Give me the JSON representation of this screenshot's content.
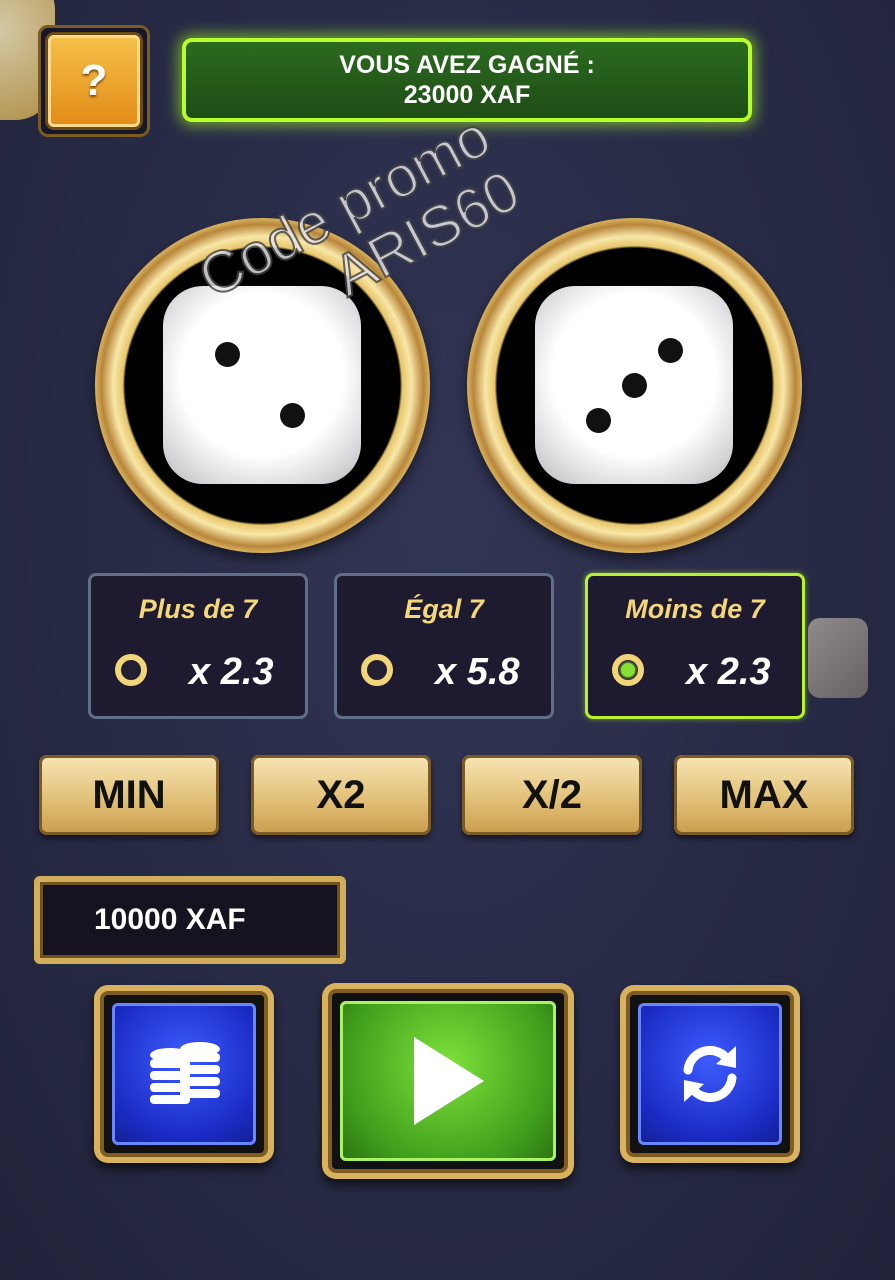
{
  "header": {
    "help_label": "?",
    "win_line1": "VOUS AVEZ GAGNÉ :",
    "win_line2": "23000 XAF"
  },
  "watermark": {
    "line1": "Code promo",
    "line2": "ARIS60"
  },
  "dice": [
    {
      "value": 2
    },
    {
      "value": 3
    }
  ],
  "bets": [
    {
      "title": "Plus de 7",
      "multiplier": "x 2.3",
      "selected": false
    },
    {
      "title": "Égal 7",
      "multiplier": "x 5.8",
      "selected": false
    },
    {
      "title": "Moins de 7",
      "multiplier": "x 2.3",
      "selected": true
    }
  ],
  "amount_buttons": [
    "MIN",
    "X2",
    "X/2",
    "MAX"
  ],
  "stake": {
    "value": "10000 XAF"
  },
  "controls": {
    "chips_icon": "coins-stack-icon",
    "play_icon": "play-icon",
    "refresh_icon": "refresh-icon"
  },
  "colors": {
    "accent_green": "#b7ff2a",
    "gold": "#e2c178",
    "blue": "#1a2bc3"
  }
}
